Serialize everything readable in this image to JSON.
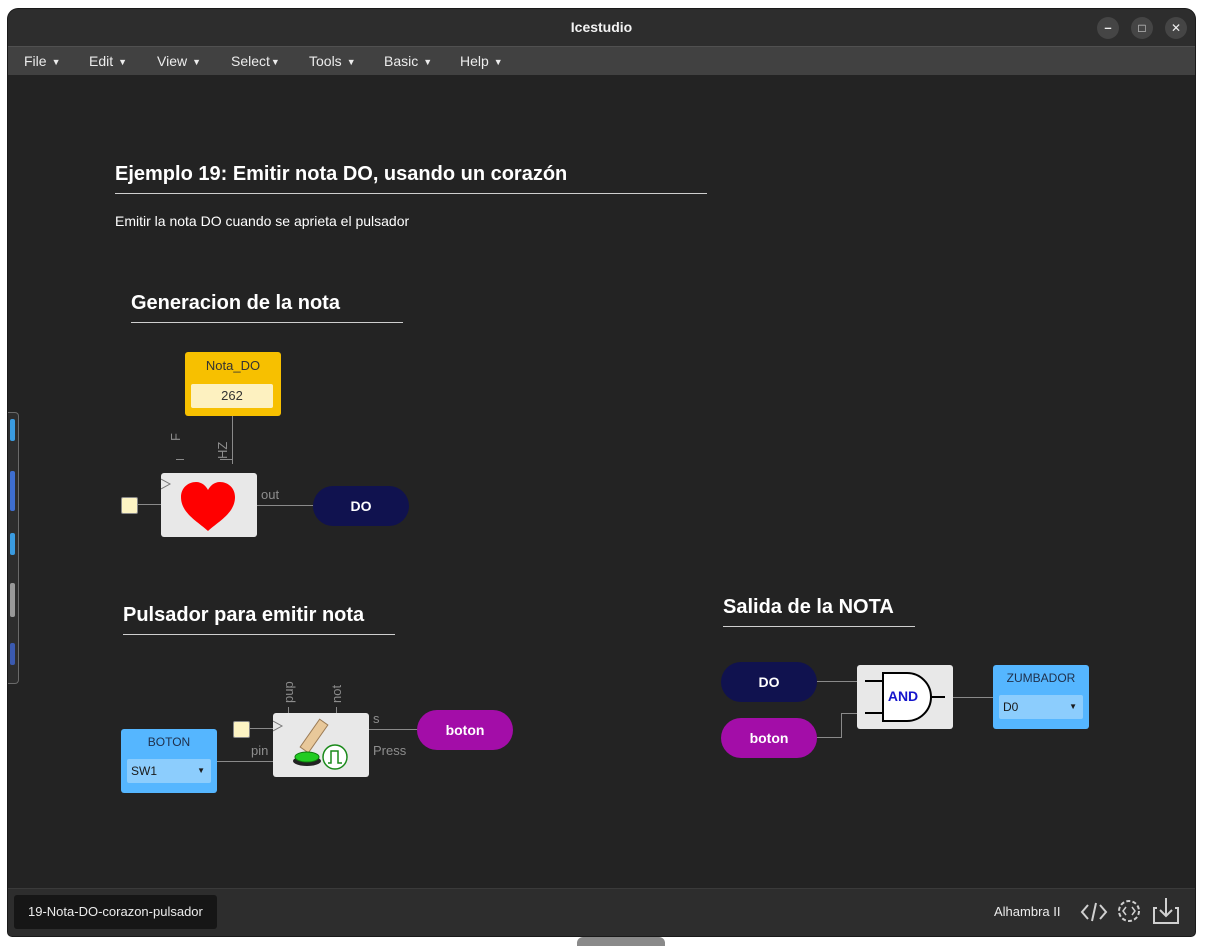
{
  "window": {
    "title": "Icestudio",
    "controls": {
      "minimize": "–",
      "maximize": "□",
      "close": "✕"
    }
  },
  "menu": {
    "file": "File",
    "edit": "Edit",
    "view": "View",
    "select": "Select",
    "tools": "Tools",
    "basic": "Basic",
    "help": "Help"
  },
  "canvas": {
    "title": "Ejemplo 19: Emitir nota DO, usando un corazón",
    "description": "Emitir la nota DO cuando se aprieta el pulsador",
    "section_generation": "Generacion de la nota",
    "section_button": "Pulsador para emitir nota",
    "section_output": "Salida de la NOTA",
    "constant": {
      "name": "Nota_DO",
      "value": "262"
    },
    "heart_ports": {
      "f": "F",
      "hz": "HZ",
      "out": "out"
    },
    "label_do": "DO",
    "button_ports": {
      "pup": "pup",
      "not": "not",
      "s": "s",
      "pin": "pin",
      "press": "Press"
    },
    "label_boton": "boton",
    "input_pin": {
      "title": "BOTON",
      "value": "SW1"
    },
    "output_do": "DO",
    "output_boton": "boton",
    "and_gate": "AND",
    "output_pin": {
      "title": "ZUMBADOR",
      "value": "D0"
    },
    "colors": {
      "label_do": "#10124f",
      "label_boton": "#a30da8",
      "pin_block": "#55b6ff",
      "constant": "#f7c000"
    }
  },
  "status": {
    "file_tab": "19-Nota-DO-corazon-pulsador",
    "board": "Alhambra II",
    "icons": [
      "code-icon",
      "settings-code-icon",
      "download-icon"
    ]
  }
}
